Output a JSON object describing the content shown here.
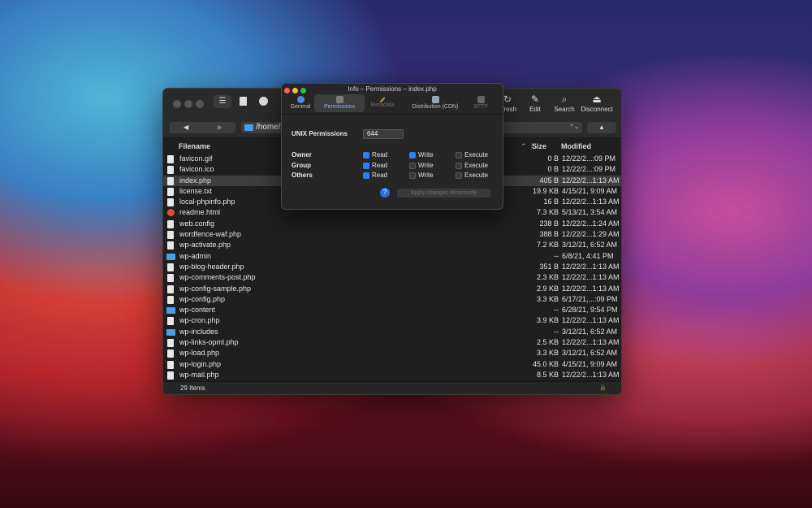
{
  "main": {
    "toolbar": {
      "tools": [
        {
          "label": "Refresh",
          "display": "efresh",
          "icon": "refresh-icon",
          "glyph": "↻"
        },
        {
          "label": "Edit",
          "display": "Edit",
          "icon": "pencil-icon",
          "glyph": "✎"
        },
        {
          "label": "Search",
          "display": "Search",
          "icon": "magnifier-icon",
          "glyph": "⌕"
        },
        {
          "label": "Disconnect",
          "display": "Disconnect",
          "icon": "eject-icon",
          "glyph": "⏏"
        }
      ]
    },
    "nav": {
      "back_glyph": "◀",
      "forward_glyph": "▶",
      "path": "/home/",
      "dropdown_glyph": "⌃⌄",
      "up_glyph": "▲"
    },
    "columns": {
      "filename": "Filename",
      "size": "Size",
      "modified": "Modified",
      "sort_glyph": "⌃"
    },
    "files": [
      {
        "name": "favicon.gif",
        "size": "0 B",
        "modified": "12/22/2...:09 PM",
        "kind": "file"
      },
      {
        "name": "favicon.ico",
        "size": "0 B",
        "modified": "12/22/2...:09 PM",
        "kind": "file"
      },
      {
        "name": "index.php",
        "size": "405 B",
        "modified": "12/22/2...1:13 AM",
        "kind": "file",
        "selected": true
      },
      {
        "name": "license.txt",
        "size": "19.9 KB",
        "modified": "4/15/21, 9:09 AM",
        "kind": "file"
      },
      {
        "name": "local-phpinfo.php",
        "size": "16 B",
        "modified": "12/22/2...1:13 AM",
        "kind": "file"
      },
      {
        "name": "readme.html",
        "size": "7.3 KB",
        "modified": "5/13/21, 3:54 AM",
        "kind": "html"
      },
      {
        "name": "web.config",
        "size": "238 B",
        "modified": "12/22/2...1:24 AM",
        "kind": "file"
      },
      {
        "name": "wordfence-waf.php",
        "size": "388 B",
        "modified": "12/22/2...1:29 AM",
        "kind": "file"
      },
      {
        "name": "wp-activate.php",
        "size": "7.2 KB",
        "modified": "3/12/21, 6:52 AM",
        "kind": "file"
      },
      {
        "name": "wp-admin",
        "size": "--",
        "modified": "6/8/21, 4:41 PM",
        "kind": "folder"
      },
      {
        "name": "wp-blog-header.php",
        "size": "351 B",
        "modified": "12/22/2...1:13 AM",
        "kind": "file"
      },
      {
        "name": "wp-comments-post.php",
        "size": "2.3 KB",
        "modified": "12/22/2...1:13 AM",
        "kind": "file"
      },
      {
        "name": "wp-config-sample.php",
        "size": "2.9 KB",
        "modified": "12/22/2...1:13 AM",
        "kind": "file"
      },
      {
        "name": "wp-config.php",
        "size": "3.3 KB",
        "modified": "6/17/21,...:09 PM",
        "kind": "file"
      },
      {
        "name": "wp-content",
        "size": "--",
        "modified": "6/28/21, 9:54 PM",
        "kind": "folder"
      },
      {
        "name": "wp-cron.php",
        "size": "3.9 KB",
        "modified": "12/22/2...1:13 AM",
        "kind": "file"
      },
      {
        "name": "wp-includes",
        "size": "--",
        "modified": "3/12/21, 6:52 AM",
        "kind": "folder"
      },
      {
        "name": "wp-links-opml.php",
        "size": "2.5 KB",
        "modified": "12/22/2...1:13 AM",
        "kind": "file"
      },
      {
        "name": "wp-load.php",
        "size": "3.3 KB",
        "modified": "3/12/21, 6:52 AM",
        "kind": "file"
      },
      {
        "name": "wp-login.php",
        "size": "45.0 KB",
        "modified": "4/15/21, 9:09 AM",
        "kind": "file"
      },
      {
        "name": "wp-mail.php",
        "size": "8.5 KB",
        "modified": "12/22/2...1:13 AM",
        "kind": "file"
      }
    ],
    "status": {
      "count": "29 Items",
      "lock_glyph": "🔒"
    }
  },
  "info": {
    "title": "Info – Permissions – index.php",
    "tabs": [
      {
        "label": "General",
        "icon": "info-icon",
        "state": "normal"
      },
      {
        "label": "Permissions",
        "icon": "lock-icon",
        "state": "active"
      },
      {
        "label": "Metadata",
        "icon": "pencil-icon",
        "state": "disabled"
      },
      {
        "label": "Distribution (CDN)",
        "icon": "drive-icon",
        "state": "normal"
      },
      {
        "label": "SFTP",
        "icon": "drive-icon",
        "state": "disabled"
      }
    ],
    "unix_label": "UNIX Permissions",
    "octal": "644",
    "rows": [
      {
        "label": "Owner",
        "read": true,
        "write": true,
        "execute": false
      },
      {
        "label": "Group",
        "read": true,
        "write": false,
        "execute": false
      },
      {
        "label": "Others",
        "read": true,
        "write": false,
        "execute": false
      }
    ],
    "read_label": "Read",
    "write_label": "Write",
    "execute_label": "Execute",
    "help_glyph": "?",
    "apply_label": "Apply changes recursively"
  },
  "colors": {
    "accent": "#2f7ef5",
    "selection": "#3d3d3d",
    "folder": "#4a9ee8"
  }
}
